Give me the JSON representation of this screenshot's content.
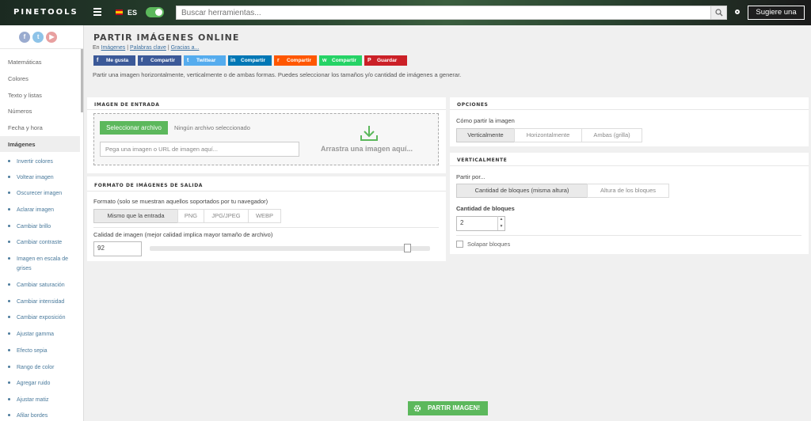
{
  "header": {
    "logo": "PINETOOLS",
    "lang": "ES",
    "search_placeholder": "Buscar herramientas...",
    "suggest": "Sugiere una"
  },
  "sidebar": {
    "social": [
      "f",
      "t",
      "▶"
    ],
    "categories": [
      "Matemáticas",
      "Colores",
      "Texto y listas",
      "Números",
      "Fecha y hora",
      "Imágenes"
    ],
    "active": "Imágenes",
    "tools": [
      "Invertir colores",
      "Voltear imagen",
      "Oscurecer imagen",
      "Aclarar imagen",
      "Cambiar brillo",
      "Cambiar contraste",
      "Imagen en escala de grises",
      "Cambiar saturación",
      "Cambiar intensidad",
      "Cambiar exposición",
      "Ajustar gamma",
      "Efecto sepia",
      "Rango de color",
      "Agregar ruido",
      "Ajustar matiz",
      "Afilar bordes"
    ]
  },
  "page": {
    "title": "PARTIR IMÁGENES ONLINE",
    "crumb_prefix": "En",
    "crumbs": [
      "Imágenes",
      "Palabras clave",
      "Gracias a..."
    ],
    "share": [
      {
        "label": "Me gusta",
        "icon": "f",
        "color": "#3b5998"
      },
      {
        "label": "Compartir",
        "icon": "f",
        "color": "#3b5998"
      },
      {
        "label": "Twittear",
        "icon": "t",
        "color": "#55acee"
      },
      {
        "label": "Compartir",
        "icon": "in",
        "color": "#0077b5"
      },
      {
        "label": "Compartir",
        "icon": "r",
        "color": "#ff5700"
      },
      {
        "label": "Compartir",
        "icon": "w",
        "color": "#25d366"
      },
      {
        "label": "Guardar",
        "icon": "P",
        "color": "#cb2027"
      }
    ],
    "description": "Partir una imagen horizontalmente, verticalmente o de ambas formas. Puedes seleccionar los tamaños y/o cantidad de imágenes a generar."
  },
  "input_panel": {
    "heading": "IMAGEN DE ENTRADA",
    "select_button": "Seleccionar archivo",
    "no_file": "Ningún archivo seleccionado",
    "url_placeholder": "Pega una imagen o URL de imagen aquí...",
    "drag_text": "Arrastra una imagen aquí..."
  },
  "output_panel": {
    "heading": "FORMATO DE IMÁGENES DE SALIDA",
    "format_label": "Formato (solo se muestran aquellos soportados por tu navegador)",
    "formats": [
      "Mismo que la entrada",
      "PNG",
      "JPG/JPEG",
      "WEBP"
    ],
    "selected_format": "Mismo que la entrada",
    "quality_label": "Calidad de imagen (mejor calidad implica mayor tamaño de archivo)",
    "quality": "92"
  },
  "options_panel": {
    "heading": "OPCIONES",
    "split_label": "Cómo partir la imagen",
    "split_options": [
      "Verticalmente",
      "Horizontalmente",
      "Ambas (grilla)"
    ],
    "selected": "Verticalmente"
  },
  "vertical_panel": {
    "heading": "VERTICALMENTE",
    "split_by_label": "Partir por...",
    "split_by_options": [
      "Cantidad de bloques (misma altura)",
      "Altura de los bloques"
    ],
    "blocks_label": "Cantidad de bloques",
    "blocks": "2",
    "overlap_label": "Solapar bloques"
  },
  "run_button": "PARTIR IMAGEN!"
}
